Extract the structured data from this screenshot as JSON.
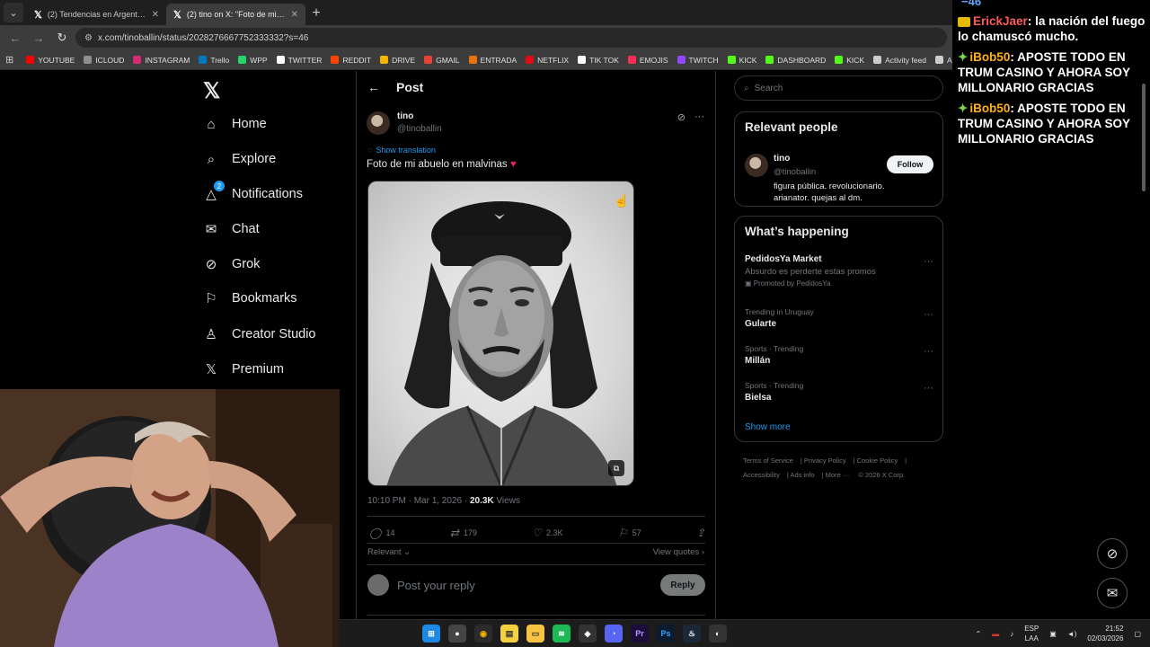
{
  "browser": {
    "tabs": [
      {
        "title": "(2) Tendencias en Argentina on",
        "active": false
      },
      {
        "title": "(2) tino on X: \"Foto de mi abuel",
        "active": true
      }
    ],
    "url": "x.com/tinoballin/status/2028276667752333332?s=46",
    "bookmarks": [
      {
        "label": "YOUTUBE",
        "color": "#ff0000"
      },
      {
        "label": "ICLOUD",
        "color": "#8e8e93"
      },
      {
        "label": "INSTAGRAM",
        "color": "#d62976"
      },
      {
        "label": "Trello",
        "color": "#0079bf"
      },
      {
        "label": "WPP",
        "color": "#25d366"
      },
      {
        "label": "TWITTER",
        "color": "#ffffff"
      },
      {
        "label": "REDDIT",
        "color": "#ff4500"
      },
      {
        "label": "DRIVE",
        "color": "#f4b400"
      },
      {
        "label": "GMAIL",
        "color": "#ea4335"
      },
      {
        "label": "ENTRADA",
        "color": "#e8720c"
      },
      {
        "label": "NETFLIX",
        "color": "#e50914"
      },
      {
        "label": "TIK TOK",
        "color": "#ffffff"
      },
      {
        "label": "EMOJIS",
        "color": "#ff2d55"
      },
      {
        "label": "TWITCH",
        "color": "#9146ff"
      },
      {
        "label": "KICK",
        "color": "#53fc18"
      },
      {
        "label": "DASHBOARD",
        "color": "#53fc18"
      },
      {
        "label": "KICK",
        "color": "#53fc18"
      },
      {
        "label": "Activity feed",
        "color": "#cccccc"
      },
      {
        "label": "ANTISCUFF",
        "color": "#cccccc"
      }
    ]
  },
  "nav": {
    "items": [
      {
        "label": "Home",
        "icon": "home-icon"
      },
      {
        "label": "Explore",
        "icon": "search-icon"
      },
      {
        "label": "Notifications",
        "icon": "bell-icon",
        "badge": "2"
      },
      {
        "label": "Chat",
        "icon": "mail-icon"
      },
      {
        "label": "Grok",
        "icon": "grok-icon"
      },
      {
        "label": "Bookmarks",
        "icon": "bookmark-icon"
      },
      {
        "label": "Creator Studio",
        "icon": "creator-icon"
      },
      {
        "label": "Premium",
        "icon": "x-icon"
      }
    ]
  },
  "post": {
    "header": "Post",
    "author_name": "tino",
    "author_handle": "@tinoballin",
    "show_translation": "Show translation",
    "text": "Foto de mi abuelo en malvinas",
    "timestamp": "10:10 PM · Mar 1, 2026 · ",
    "views_count": "20.3K",
    "views_label": " Views",
    "replies": "14",
    "reposts": "179",
    "likes": "2.3K",
    "bookmarks": "57",
    "relevant": "Relevant",
    "view_quotes": "View quotes",
    "reply_placeholder": "Post your reply",
    "reply_button": "Reply"
  },
  "sidebar": {
    "search_placeholder": "Search",
    "relevant_people": {
      "title": "Relevant people",
      "name": "tino",
      "handle": "@tinoballin",
      "bio": "figura pública. revolucionario. arianator. quejas al dm.",
      "follow": "Follow"
    },
    "happening": {
      "title": "What’s happening",
      "promo": {
        "name": "PedidosYa Market",
        "sub": "Absurdo es perderte estas promos",
        "promoted": "Promoted by PedidosYa"
      },
      "trends": [
        {
          "context": "Trending in Uruguay",
          "name": "Gularte"
        },
        {
          "context": "Sports · Trending",
          "name": "Millán"
        },
        {
          "context": "Sports · Trending",
          "name": "Bielsa"
        }
      ],
      "show_more": "Show more"
    },
    "footer": [
      "Terms of Service",
      "Privacy Policy",
      "Cookie Policy",
      "Accessibility",
      "Ads info",
      "More ···",
      "© 2026 X Corp."
    ]
  },
  "chat": {
    "top_fragment": "−46",
    "messages": [
      {
        "user": "ErickJaer",
        "text": " la nación del fuego lo chamuscó mucho.",
        "user_color": "#ff5a5a"
      },
      {
        "user": "iBob50",
        "text": " APOSTE TODO EN TRUM CASINO Y AHORA SOY MILLONARIO GRACIAS",
        "user_color": "#ffb020"
      },
      {
        "user": "iBob50",
        "text": " APOSTE TODO EN TRUM CASINO Y AHORA SOY MILLONARIO GRACIAS",
        "user_color": "#ffb020"
      }
    ]
  },
  "taskbar": {
    "lang_top": "ESP",
    "lang_bottom": "LAA",
    "time": "21:52",
    "date": "02/03/2026"
  }
}
